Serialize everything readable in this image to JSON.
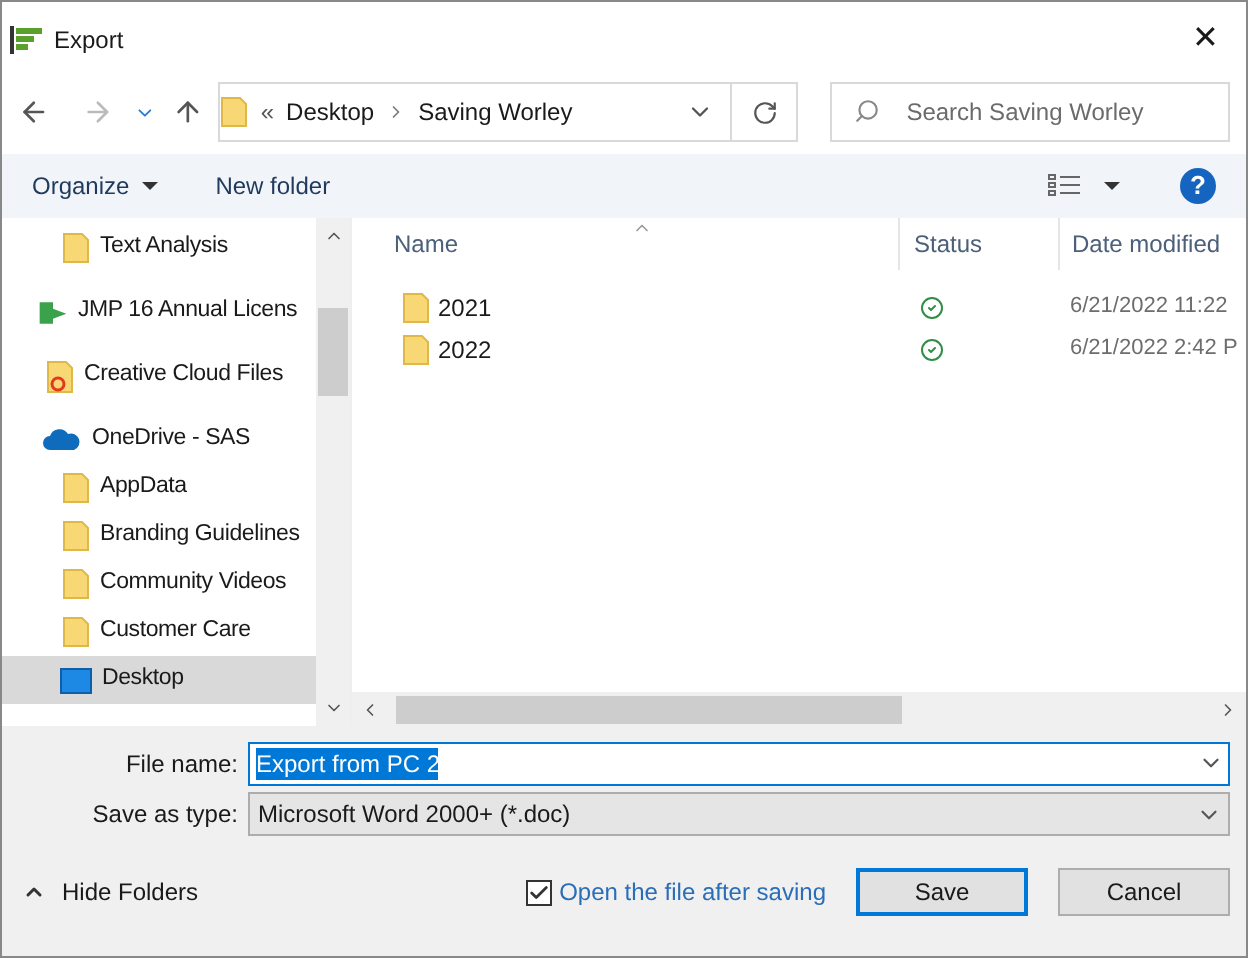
{
  "window": {
    "title": "Export",
    "close": "✕"
  },
  "nav": {
    "path": [
      "Desktop",
      "Saving Worley"
    ],
    "overflow": "«",
    "search_placeholder": "Search Saving Worley"
  },
  "toolbar": {
    "organize": "Organize",
    "new_folder": "New folder",
    "help": "?"
  },
  "sidebar": {
    "items": [
      {
        "label": "Text Analysis",
        "kind": "folder",
        "selected": false
      },
      {
        "label": "JMP 16 Annual Licens",
        "kind": "app",
        "selected": false
      },
      {
        "label": "Creative Cloud Files",
        "kind": "cloud-files",
        "selected": false
      },
      {
        "label": "OneDrive - SAS",
        "kind": "onedrive",
        "selected": false
      },
      {
        "label": "AppData",
        "kind": "folder",
        "selected": false
      },
      {
        "label": "Branding Guidelines",
        "kind": "folder",
        "selected": false
      },
      {
        "label": "Community Videos",
        "kind": "folder",
        "selected": false
      },
      {
        "label": "Customer Care",
        "kind": "folder",
        "selected": false
      },
      {
        "label": "Desktop",
        "kind": "desktop",
        "selected": true
      }
    ]
  },
  "table": {
    "columns": [
      "Name",
      "Status",
      "Date modified"
    ],
    "rows": [
      {
        "name": "2021",
        "kind": "synced",
        "date": "6/21/2022 11:22"
      },
      {
        "name": "2022",
        "kind": "synced",
        "date": "6/21/2022 2:42 P"
      }
    ]
  },
  "form": {
    "file_name_label": "File name:",
    "file_name": "Export from PC 2",
    "type_label": "Save as type:",
    "type": "Microsoft Word 2000+ (*.doc)"
  },
  "footer": {
    "hide_folders": "Hide Folders",
    "open_after": {
      "label": "Open the file after saving",
      "checked": true
    },
    "buttons": [
      {
        "label": "Save",
        "kind": "default"
      },
      {
        "label": "Cancel",
        "kind": "normal"
      }
    ]
  }
}
